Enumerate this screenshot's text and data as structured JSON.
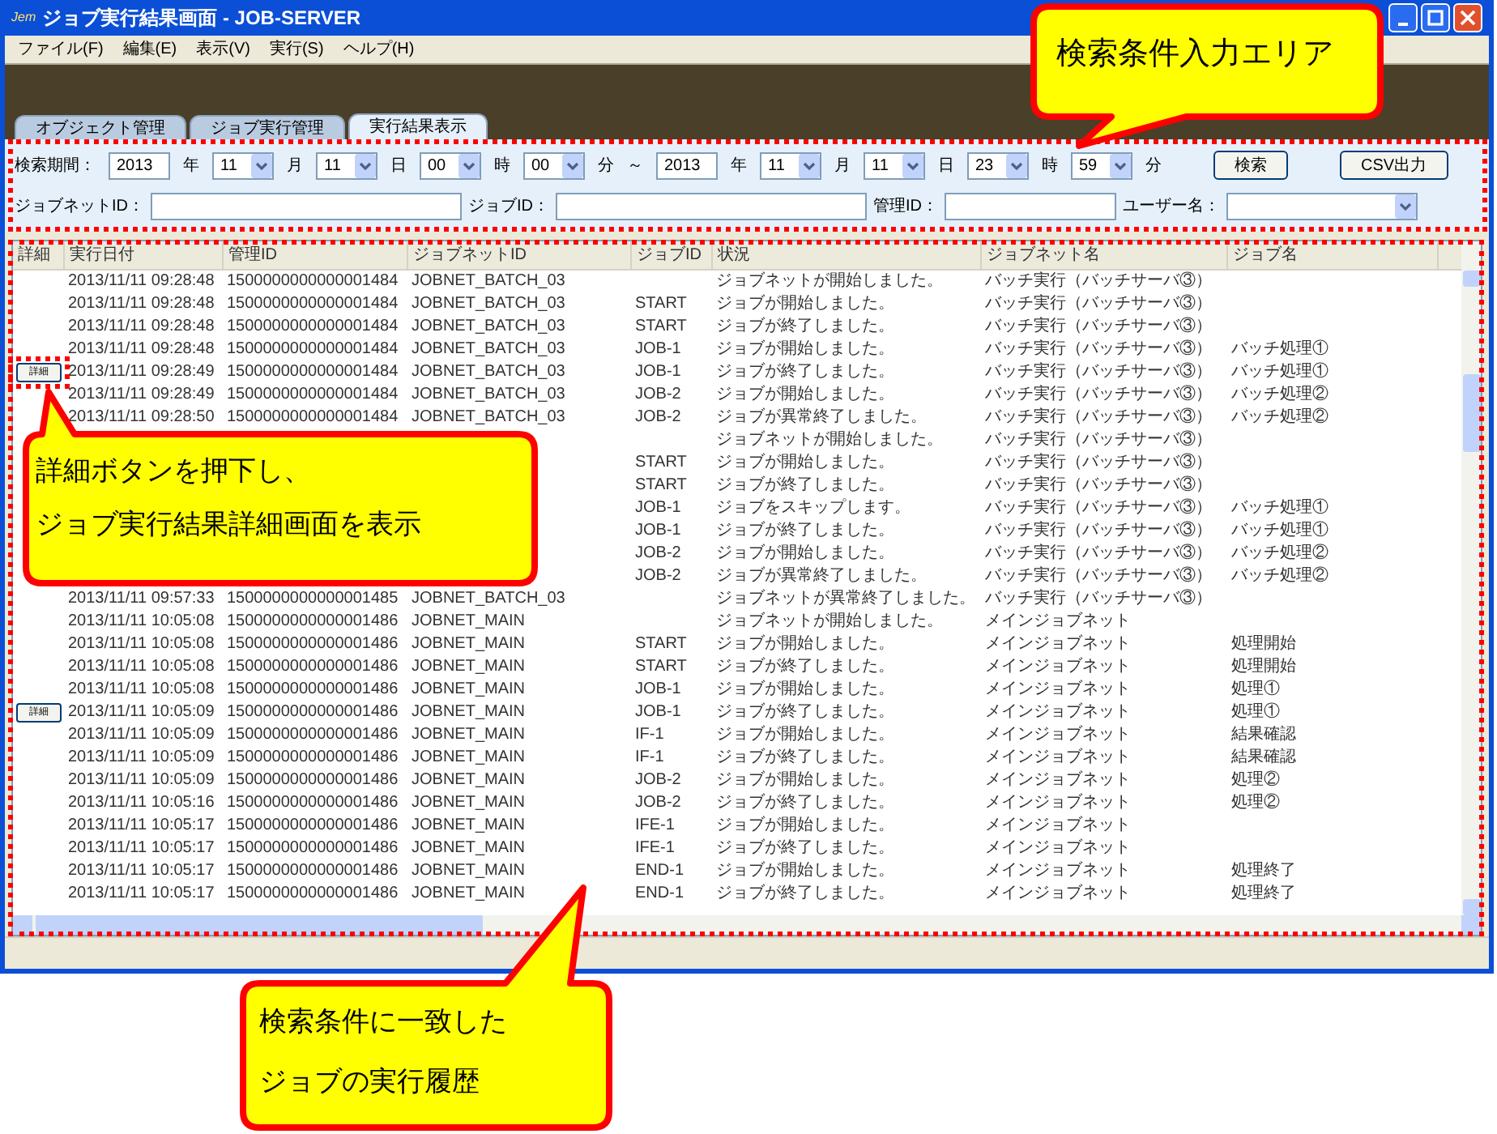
{
  "window": {
    "logo": "Jem",
    "title": "ジョブ実行結果画面 - JOB-SERVER"
  },
  "menu": [
    "ファイル(F)",
    "編集(E)",
    "表示(V)",
    "実行(S)",
    "ヘルプ(H)"
  ],
  "tabs": [
    {
      "label": "オブジェクト管理",
      "selected": false
    },
    {
      "label": "ジョブ実行管理",
      "selected": false
    },
    {
      "label": "実行結果表示",
      "selected": true
    }
  ],
  "filters": {
    "row1": [
      {
        "kind": "label",
        "text": "検索期間："
      },
      {
        "kind": "input",
        "value": "2013"
      },
      {
        "kind": "label",
        "text": "年"
      },
      {
        "kind": "select",
        "value": "11"
      },
      {
        "kind": "label",
        "text": "月"
      },
      {
        "kind": "select",
        "value": "11"
      },
      {
        "kind": "label",
        "text": "日"
      },
      {
        "kind": "select",
        "value": "00"
      },
      {
        "kind": "label",
        "text": "時"
      },
      {
        "kind": "select",
        "value": "00"
      },
      {
        "kind": "label",
        "text": "分"
      },
      {
        "kind": "label",
        "text": "～"
      },
      {
        "kind": "input",
        "value": "2013"
      },
      {
        "kind": "label",
        "text": "年"
      },
      {
        "kind": "select",
        "value": "11"
      },
      {
        "kind": "label",
        "text": "月"
      },
      {
        "kind": "select",
        "value": "11"
      },
      {
        "kind": "label",
        "text": "日"
      },
      {
        "kind": "select",
        "value": "23"
      },
      {
        "kind": "label",
        "text": "時"
      },
      {
        "kind": "select",
        "value": "59"
      },
      {
        "kind": "label",
        "text": "分"
      },
      {
        "kind": "button",
        "text": "検索"
      },
      {
        "kind": "button",
        "text": "CSV出力"
      }
    ],
    "row2": [
      {
        "kind": "label",
        "text": "ジョブネットID："
      },
      {
        "kind": "wideinput"
      },
      {
        "kind": "label",
        "text": "ジョブID："
      },
      {
        "kind": "wideinput"
      },
      {
        "kind": "label",
        "text": "管理ID："
      },
      {
        "kind": "midinput"
      },
      {
        "kind": "label",
        "text": "ユーザー名："
      },
      {
        "kind": "select"
      }
    ]
  },
  "table": {
    "columns": [
      "詳細",
      "実行日付",
      "管理ID",
      "ジョブネットID",
      "ジョブID",
      "状況",
      "ジョブネット名",
      "ジョブ名"
    ],
    "rows": [
      {
        "date": "2013/11/11 09:28:48",
        "id": "1500000000000001484",
        "jobnet": "JOBNET_BATCH_03",
        "job": "",
        "status": "ジョブネットが開始しました。",
        "jobnet_name": "バッチ実行（バッチサーバ③）",
        "job_name": ""
      },
      {
        "date": "2013/11/11 09:28:48",
        "id": "1500000000000001484",
        "jobnet": "JOBNET_BATCH_03",
        "job": "START",
        "status": "ジョブが開始しました。",
        "jobnet_name": "バッチ実行（バッチサーバ③）",
        "job_name": ""
      },
      {
        "date": "2013/11/11 09:28:48",
        "id": "1500000000000001484",
        "jobnet": "JOBNET_BATCH_03",
        "job": "START",
        "status": "ジョブが終了しました。",
        "jobnet_name": "バッチ実行（バッチサーバ③）",
        "job_name": ""
      },
      {
        "date": "2013/11/11 09:28:48",
        "id": "1500000000000001484",
        "jobnet": "JOBNET_BATCH_03",
        "job": "JOB-1",
        "status": "ジョブが開始しました。",
        "jobnet_name": "バッチ実行（バッチサーバ③）",
        "job_name": "バッチ処理①"
      },
      {
        "detail": "詳細",
        "date": "2013/11/11 09:28:49",
        "id": "1500000000000001484",
        "jobnet": "JOBNET_BATCH_03",
        "job": "JOB-1",
        "status": "ジョブが終了しました。",
        "jobnet_name": "バッチ実行（バッチサーバ③）",
        "job_name": "バッチ処理①"
      },
      {
        "date": "2013/11/11 09:28:49",
        "id": "1500000000000001484",
        "jobnet": "JOBNET_BATCH_03",
        "job": "JOB-2",
        "status": "ジョブが開始しました。",
        "jobnet_name": "バッチ実行（バッチサーバ③）",
        "job_name": "バッチ処理②"
      },
      {
        "date": "2013/11/11 09:28:50",
        "id": "1500000000000001484",
        "jobnet": "JOBNET_BATCH_03",
        "job": "JOB-2",
        "status": "ジョブが異常終了しました。",
        "jobnet_name": "バッチ実行（バッチサーバ③）",
        "job_name": "バッチ処理②"
      },
      {
        "job": "",
        "status": "ジョブネットが開始しました。",
        "jobnet_name": "バッチ実行（バッチサーバ③）",
        "job_name": ""
      },
      {
        "job": "START",
        "status": "ジョブが開始しました。",
        "jobnet_name": "バッチ実行（バッチサーバ③）",
        "job_name": ""
      },
      {
        "job": "START",
        "status": "ジョブが終了しました。",
        "jobnet_name": "バッチ実行（バッチサーバ③）",
        "job_name": ""
      },
      {
        "job": "JOB-1",
        "status": "ジョブをスキップします。",
        "jobnet_name": "バッチ実行（バッチサーバ③）",
        "job_name": "バッチ処理①"
      },
      {
        "job": "JOB-1",
        "status": "ジョブが終了しました。",
        "jobnet_name": "バッチ実行（バッチサーバ③）",
        "job_name": "バッチ処理①"
      },
      {
        "job": "JOB-2",
        "status": "ジョブが開始しました。",
        "jobnet_name": "バッチ実行（バッチサーバ③）",
        "job_name": "バッチ処理②"
      },
      {
        "job": "JOB-2",
        "status": "ジョブが異常終了しました。",
        "jobnet_name": "バッチ実行（バッチサーバ③）",
        "job_name": "バッチ処理②"
      },
      {
        "date": "2013/11/11 09:57:33",
        "id": "1500000000000001485",
        "jobnet": "JOBNET_BATCH_03",
        "job": "",
        "status": "ジョブネットが異常終了しました。",
        "jobnet_name": "バッチ実行（バッチサーバ③）",
        "job_name": ""
      },
      {
        "date": "2013/11/11 10:05:08",
        "id": "1500000000000001486",
        "jobnet": "JOBNET_MAIN",
        "job": "",
        "status": "ジョブネットが開始しました。",
        "jobnet_name": "メインジョブネット",
        "job_name": ""
      },
      {
        "date": "2013/11/11 10:05:08",
        "id": "1500000000000001486",
        "jobnet": "JOBNET_MAIN",
        "job": "START",
        "status": "ジョブが開始しました。",
        "jobnet_name": "メインジョブネット",
        "job_name": "処理開始"
      },
      {
        "date": "2013/11/11 10:05:08",
        "id": "1500000000000001486",
        "jobnet": "JOBNET_MAIN",
        "job": "START",
        "status": "ジョブが終了しました。",
        "jobnet_name": "メインジョブネット",
        "job_name": "処理開始"
      },
      {
        "date": "2013/11/11 10:05:08",
        "id": "1500000000000001486",
        "jobnet": "JOBNET_MAIN",
        "job": "JOB-1",
        "status": "ジョブが開始しました。",
        "jobnet_name": "メインジョブネット",
        "job_name": "処理①"
      },
      {
        "detail": "詳細",
        "date": "2013/11/11 10:05:09",
        "id": "1500000000000001486",
        "jobnet": "JOBNET_MAIN",
        "job": "JOB-1",
        "status": "ジョブが終了しました。",
        "jobnet_name": "メインジョブネット",
        "job_name": "処理①"
      },
      {
        "date": "2013/11/11 10:05:09",
        "id": "1500000000000001486",
        "jobnet": "JOBNET_MAIN",
        "job": "IF-1",
        "status": "ジョブが開始しました。",
        "jobnet_name": "メインジョブネット",
        "job_name": "結果確認"
      },
      {
        "date": "2013/11/11 10:05:09",
        "id": "1500000000000001486",
        "jobnet": "JOBNET_MAIN",
        "job": "IF-1",
        "status": "ジョブが終了しました。",
        "jobnet_name": "メインジョブネット",
        "job_name": "結果確認"
      },
      {
        "date": "2013/11/11 10:05:09",
        "id": "1500000000000001486",
        "jobnet": "JOBNET_MAIN",
        "job": "JOB-2",
        "status": "ジョブが開始しました。",
        "jobnet_name": "メインジョブネット",
        "job_name": "処理②"
      },
      {
        "date": "2013/11/11 10:05:16",
        "id": "1500000000000001486",
        "jobnet": "JOBNET_MAIN",
        "job": "JOB-2",
        "status": "ジョブが終了しました。",
        "jobnet_name": "メインジョブネット",
        "job_name": "処理②"
      },
      {
        "date": "2013/11/11 10:05:17",
        "id": "1500000000000001486",
        "jobnet": "JOBNET_MAIN",
        "job": "IFE-1",
        "status": "ジョブが開始しました。",
        "jobnet_name": "メインジョブネット",
        "job_name": ""
      },
      {
        "date": "2013/11/11 10:05:17",
        "id": "1500000000000001486",
        "jobnet": "JOBNET_MAIN",
        "job": "IFE-1",
        "status": "ジョブが終了しました。",
        "jobnet_name": "メインジョブネット",
        "job_name": ""
      },
      {
        "date": "2013/11/11 10:05:17",
        "id": "1500000000000001486",
        "jobnet": "JOBNET_MAIN",
        "job": "END-1",
        "status": "ジョブが開始しました。",
        "jobnet_name": "メインジョブネット",
        "job_name": "処理終了"
      },
      {
        "date": "2013/11/11 10:05:17",
        "id": "1500000000000001486",
        "jobnet": "JOBNET_MAIN",
        "job": "END-1",
        "status": "ジョブが終了しました。",
        "jobnet_name": "メインジョブネット",
        "job_name": "処理終了"
      }
    ]
  },
  "callouts": [
    {
      "kind": "top",
      "lines": [
        "検索条件入力エリア"
      ]
    },
    {
      "kind": "left",
      "lines": [
        "詳細ボタンを押下し、",
        "ジョブ実行結果詳細画面を表示"
      ]
    },
    {
      "kind": "bottom",
      "lines": [
        "検索条件に一致した",
        "ジョブの実行履歴"
      ]
    }
  ]
}
